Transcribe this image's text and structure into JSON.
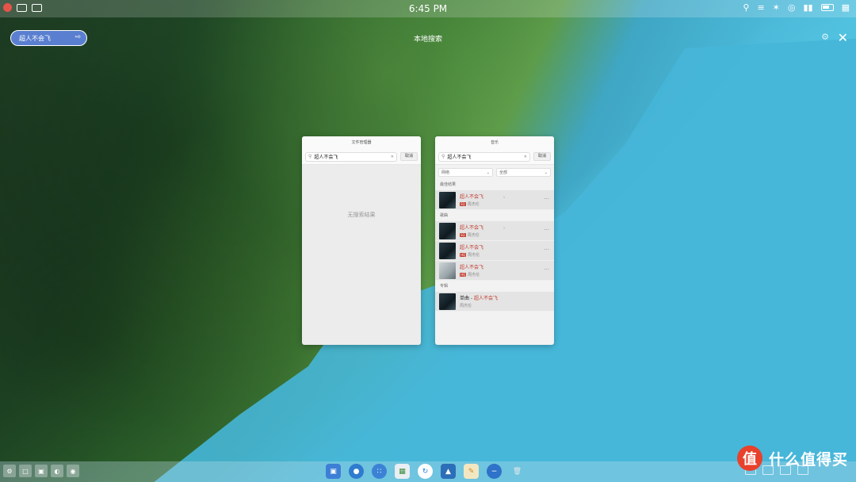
{
  "status_bar": {
    "time": "6:45 PM"
  },
  "search_pill": {
    "query": "超人不会飞"
  },
  "center_title": "本地搜索",
  "files_window": {
    "title": "文件管理器",
    "query": "超人不会飞",
    "cancel": "取消",
    "empty_text": "无搜索结果"
  },
  "music_window": {
    "title": "音乐",
    "query": "超人不会飞",
    "cancel": "取消",
    "filter_left": "网络",
    "filter_right": "全部",
    "sections": {
      "best": "最佳结果",
      "songs": "歌曲",
      "albums": "专辑"
    },
    "best_result": {
      "name": "超人不会飞",
      "tag": "SQ",
      "artist": "周杰伦"
    },
    "songs": [
      {
        "name": "超人不会飞",
        "tag": "SQ",
        "artist": "周杰伦"
      },
      {
        "name": "超人不会飞",
        "tag": "HQ",
        "artist": "周杰伦"
      },
      {
        "name": "超人不会飞",
        "tag": "HQ",
        "artist": "周杰伦"
      }
    ],
    "album": {
      "prefix": "单曲 - ",
      "name": "超人不会飞",
      "artist": "周杰伦"
    }
  },
  "watermark": {
    "logo": "值",
    "text": "什么值得买"
  },
  "colors": {
    "pill": "#5a7fd0",
    "accent": "#c0392b"
  }
}
